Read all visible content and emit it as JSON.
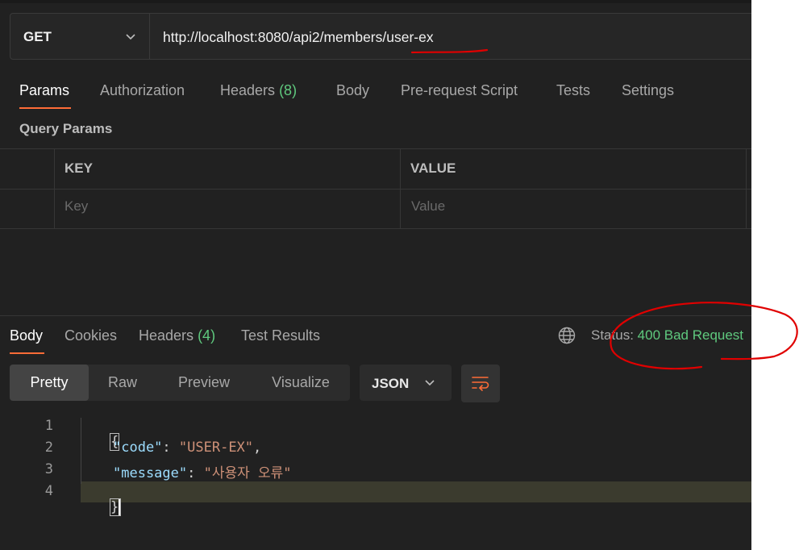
{
  "request": {
    "method": "GET",
    "url": "http://localhost:8080/api2/members/user-ex"
  },
  "request_tabs": [
    {
      "label": "Params",
      "count": ""
    },
    {
      "label": "Authorization",
      "count": ""
    },
    {
      "label": "Headers",
      "count": "(8)"
    },
    {
      "label": "Body",
      "count": ""
    },
    {
      "label": "Pre-request Script",
      "count": ""
    },
    {
      "label": "Tests",
      "count": ""
    },
    {
      "label": "Settings",
      "count": ""
    }
  ],
  "params": {
    "title": "Query Params",
    "columns": [
      "KEY",
      "VALUE"
    ],
    "placeholders": {
      "key": "Key",
      "value": "Value"
    }
  },
  "response": {
    "tabs": [
      {
        "label": "Body",
        "count": ""
      },
      {
        "label": "Cookies",
        "count": ""
      },
      {
        "label": "Headers",
        "count": "(4)"
      },
      {
        "label": "Test Results",
        "count": ""
      }
    ],
    "status_label": "Status:",
    "status_value": "400 Bad Request",
    "view_modes": [
      "Pretty",
      "Raw",
      "Preview",
      "Visualize"
    ],
    "format": "JSON",
    "code": {
      "line_numbers": [
        "1",
        "2",
        "3",
        "4"
      ],
      "open_brace": "{",
      "close_brace": "}",
      "key1": "\"code\"",
      "val1": "\"USER-EX\"",
      "key2": "\"message\"",
      "val2": "\"사용자 오류\"",
      "colon": ": ",
      "comma": ","
    }
  },
  "colors": {
    "accent": "#ff6c37",
    "success": "#5fc97e",
    "annotation": "#e00000",
    "background": "#212121"
  }
}
